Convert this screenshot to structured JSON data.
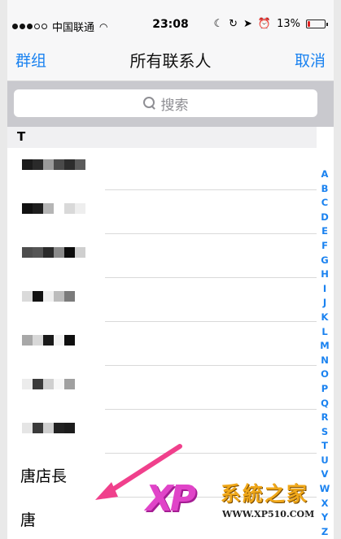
{
  "status_bar": {
    "carrier": "中国联通",
    "time": "23:08",
    "battery_percent": "13%",
    "battery_level": 0.13
  },
  "nav": {
    "left_label": "群组",
    "title": "所有联系人",
    "right_label": "取消"
  },
  "search": {
    "placeholder": "搜索"
  },
  "section": {
    "header": "T"
  },
  "contacts": [
    {
      "name": "",
      "pixels": [
        "#1b1b1b",
        "#2a2a2a",
        "#9a9a9a",
        "#4a4a4a",
        "#2d2d2d",
        "#5b5b5b"
      ]
    },
    {
      "name": "",
      "pixels": [
        "#111111",
        "#1e1e1e",
        "#b5b5b5",
        "#ffffff",
        "#d9d9d9",
        "#eeeeee"
      ]
    },
    {
      "name": "",
      "pixels": [
        "#4d4d4d",
        "#555555",
        "#2a2a2a",
        "#8a8a8a",
        "#0c0c0c",
        "#cfcfcf"
      ]
    },
    {
      "name": "",
      "pixels": [
        "#dadada",
        "#121212",
        "#f0f0f0",
        "#bcbcbc",
        "#7b7b7b",
        "#ffffff"
      ]
    },
    {
      "name": "",
      "pixels": [
        "#a8a8a8",
        "#d8d8d8",
        "#1a1a1a",
        "#f3f3f3",
        "#0f0f0f",
        "#ffffff"
      ]
    },
    {
      "name": "",
      "pixels": [
        "#ececec",
        "#3a3a3a",
        "#cfcfcf",
        "#f7f7f7",
        "#a0a0a0",
        "#ffffff"
      ]
    },
    {
      "name": "",
      "pixels": [
        "#e5e5e5",
        "#3a3a3a",
        "#cfcfcf",
        "#222222",
        "#1c1c1c",
        "#ffffff"
      ]
    },
    {
      "name": "唐店長",
      "pixels": []
    },
    {
      "name": "唐",
      "pixels": []
    }
  ],
  "index_letters": [
    "A",
    "B",
    "C",
    "D",
    "E",
    "F",
    "G",
    "H",
    "I",
    "J",
    "K",
    "L",
    "M",
    "N",
    "O",
    "P",
    "Q",
    "R",
    "S",
    "T",
    "U",
    "V",
    "W",
    "X",
    "Y",
    "Z",
    "#"
  ],
  "watermark": {
    "logo": "XP",
    "title": "系統之家",
    "url": "WWW.XP510.COM"
  },
  "colors": {
    "accent": "#1a82f0",
    "arrow": "#f0408c"
  }
}
